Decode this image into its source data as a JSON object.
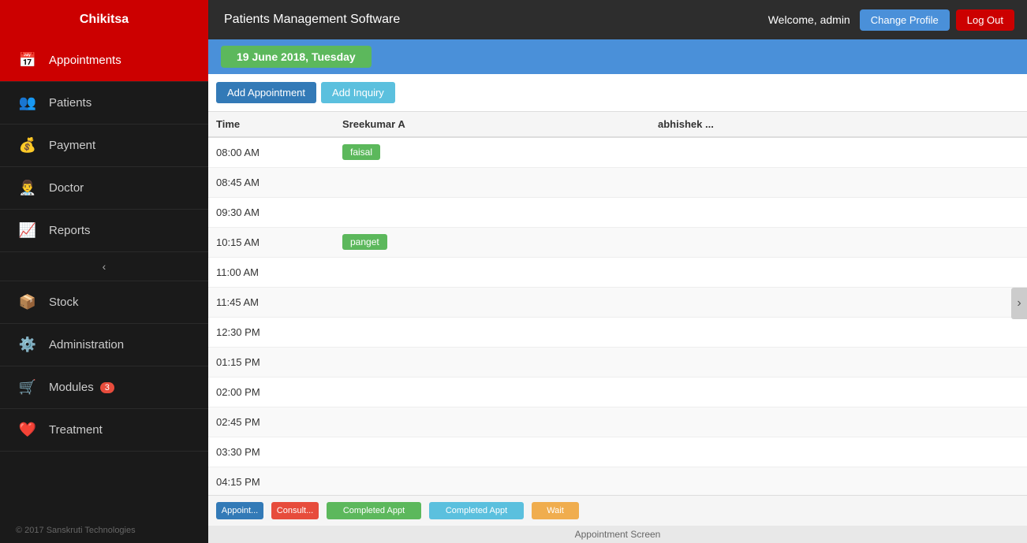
{
  "header": {
    "app_title": "Chikitsa",
    "page_title": "Patients Management Software",
    "welcome_text": "Welcome, admin",
    "change_profile_label": "Change Profile",
    "logout_label": "Log Out"
  },
  "sidebar": {
    "items": [
      {
        "id": "appointments",
        "label": "Appointments",
        "icon": "📅",
        "active": true,
        "badge": null
      },
      {
        "id": "patients",
        "label": "Patients",
        "icon": "👥",
        "active": false,
        "badge": null
      },
      {
        "id": "payment",
        "label": "Payment",
        "icon": "💰",
        "active": false,
        "badge": null
      },
      {
        "id": "doctor",
        "label": "Doctor",
        "icon": "👨‍⚕️",
        "active": false,
        "badge": null
      },
      {
        "id": "reports",
        "label": "Reports",
        "icon": "📈",
        "active": false,
        "badge": null
      },
      {
        "id": "stock",
        "label": "Stock",
        "icon": "📦",
        "active": false,
        "badge": null
      },
      {
        "id": "administration",
        "label": "Administration",
        "icon": "⚙️",
        "active": false,
        "badge": null
      },
      {
        "id": "modules",
        "label": "Modules",
        "icon": "🛒",
        "active": false,
        "badge": "3"
      },
      {
        "id": "treatment",
        "label": "Treatment",
        "icon": "❤️",
        "active": false,
        "badge": null
      }
    ],
    "footer": "© 2017 Sanskruti Technologies"
  },
  "main": {
    "date_label": "19 June 2018, Tuesday",
    "toolbar": {
      "add_appointment_label": "Add Appointment",
      "add_inquiry_label": "Add Inquiry"
    },
    "columns": [
      {
        "id": "time",
        "label": "Time"
      },
      {
        "id": "sreekumar",
        "label": "Sreekumar A"
      },
      {
        "id": "abhishek",
        "label": "abhishek ..."
      }
    ],
    "rows": [
      {
        "time": "08:00 AM",
        "sreekumar": "faisal",
        "sreekumar_color": "green",
        "abhishek": ""
      },
      {
        "time": "08:45 AM",
        "sreekumar": "",
        "abhishek": ""
      },
      {
        "time": "09:30 AM",
        "sreekumar": "",
        "abhishek": ""
      },
      {
        "time": "10:15 AM",
        "sreekumar": "panget",
        "sreekumar_color": "green",
        "abhishek": ""
      },
      {
        "time": "11:00 AM",
        "sreekumar": "",
        "abhishek": ""
      },
      {
        "time": "11:45 AM",
        "sreekumar": "",
        "abhishek": ""
      },
      {
        "time": "12:30 PM",
        "sreekumar": "",
        "abhishek": ""
      },
      {
        "time": "01:15 PM",
        "sreekumar": "",
        "abhishek": ""
      },
      {
        "time": "02:00 PM",
        "sreekumar": "",
        "abhishek": ""
      },
      {
        "time": "02:45 PM",
        "sreekumar": "",
        "abhishek": ""
      },
      {
        "time": "03:30 PM",
        "sreekumar": "",
        "abhishek": ""
      },
      {
        "time": "04:15 PM",
        "sreekumar": "",
        "abhishek": ""
      }
    ],
    "legend": [
      {
        "label": "Appointment",
        "color": "#337ab7"
      },
      {
        "label": "Consultation",
        "color": "#e74c3c"
      },
      {
        "label": "Completed Appointment",
        "color": "#5cb85c"
      },
      {
        "label": "Completed Appointment",
        "color": "#5bc0de"
      },
      {
        "label": "Wait",
        "color": "#f0ad4e"
      }
    ],
    "screen_label": "Appointment Screen"
  },
  "colors": {
    "sidebar_bg": "#1a1a1a",
    "active_bg": "#cc0000",
    "header_bg": "#2d2d2d",
    "date_header_bg": "#4a90d9",
    "date_badge_bg": "#5cb85c",
    "change_profile_bg": "#4a90d9",
    "logout_bg": "#cc0000"
  }
}
